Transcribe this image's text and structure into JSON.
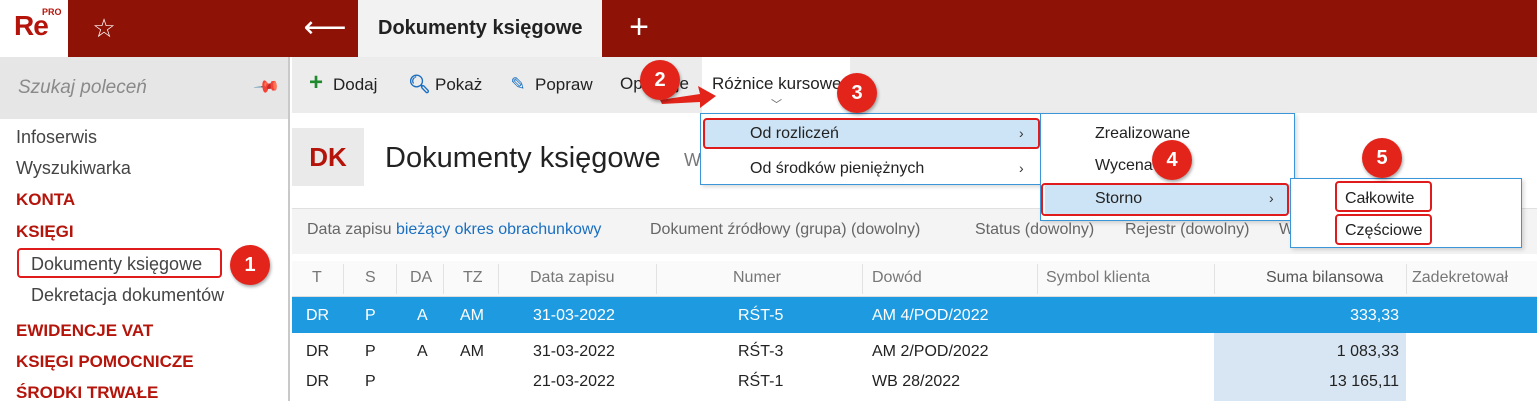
{
  "app": {
    "logo_text": "Re",
    "logo_sup": "PRO",
    "active_tab": "Dokumenty księgowe"
  },
  "sidebar": {
    "search_placeholder": "Szukaj poleceń",
    "items": [
      {
        "label": "Infoserwis",
        "type": "item"
      },
      {
        "label": "Wyszukiwarka",
        "type": "item"
      },
      {
        "label": "KONTA",
        "type": "section"
      },
      {
        "label": "KSIĘGI",
        "type": "section"
      },
      {
        "label": "Dokumenty księgowe",
        "type": "sub"
      },
      {
        "label": "Dekretacja dokumentów",
        "type": "sub"
      },
      {
        "label": "EWIDENCJE VAT",
        "type": "section"
      },
      {
        "label": "KSIĘGI POMOCNICZE",
        "type": "section"
      },
      {
        "label": "ŚRODKI TRWAŁE",
        "type": "section"
      }
    ]
  },
  "toolbar": {
    "add_label": "Dodaj",
    "show_label": "Pokaż",
    "edit_label": "Popraw",
    "operations_label": "Operacje",
    "fx_label": "Różnice kursowe"
  },
  "header": {
    "badge": "DK",
    "title": "Dokumenty księgowe",
    "title_suffix": "W"
  },
  "filters": {
    "date_label": "Data zapisu",
    "date_value": "bieżący okres obrachunkowy",
    "source_doc": "Dokument źródłowy (grupa) (dowolny)",
    "status": "Status (dowolny)",
    "register": "Rejestr (dowolny)",
    "more": "W"
  },
  "table": {
    "columns": [
      "T",
      "S",
      "DA",
      "TZ",
      "Data zapisu",
      "Numer",
      "Dowód",
      "Symbol klienta",
      "Suma bilansowa",
      "Zadekretował"
    ],
    "rows": [
      {
        "t": "DR",
        "s": "P",
        "da": "A",
        "tz": "AM",
        "date": "31-03-2022",
        "num": "RŚT-5",
        "proof": "AM 4/POD/2022",
        "client": "",
        "sum": "333,33",
        "who": ""
      },
      {
        "t": "DR",
        "s": "P",
        "da": "A",
        "tz": "AM",
        "date": "31-03-2022",
        "num": "RŚT-3",
        "proof": "AM 2/POD/2022",
        "client": "",
        "sum": "1 083,33",
        "who": ""
      },
      {
        "t": "DR",
        "s": "P",
        "da": "",
        "tz": "",
        "date": "21-03-2022",
        "num": "RŚT-1",
        "proof": "WB 28/2022",
        "client": "",
        "sum": "13 165,11",
        "who": ""
      }
    ]
  },
  "menus": {
    "level1": [
      "Od rozliczeń",
      "Od środków pieniężnych"
    ],
    "level2": [
      "Zrealizowane",
      "Wycena",
      "Storno"
    ],
    "level3": [
      "Całkowite",
      "Częściowe"
    ]
  },
  "annotations": [
    "1",
    "2",
    "3",
    "4",
    "5"
  ],
  "colors": {
    "brand": "#8f1206",
    "accent": "#b5140b",
    "selection": "#1e9be0",
    "link": "#1b6fc0",
    "annotation": "#e3241b"
  }
}
